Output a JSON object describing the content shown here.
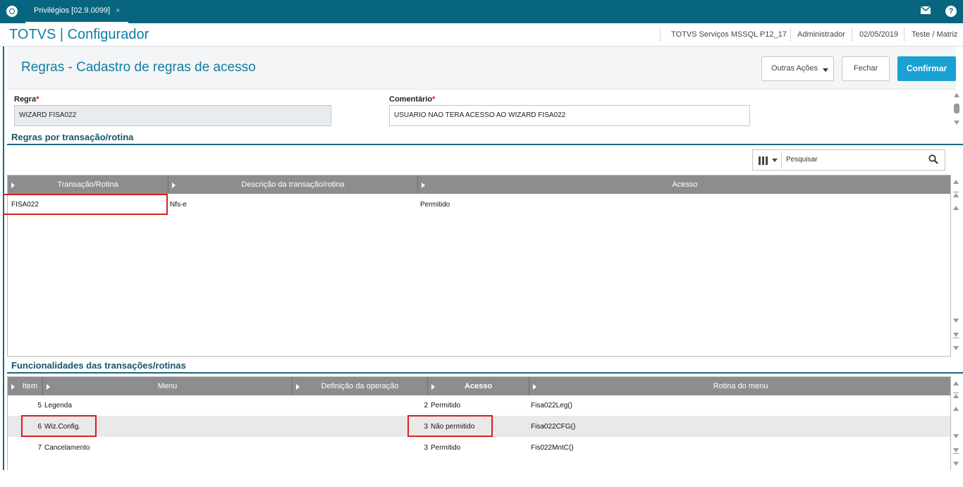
{
  "topbar": {
    "tab_label": "Privilégios [02.9.0099]",
    "tab_close": "×",
    "mail_icon": "envelope-icon",
    "help_label": "?"
  },
  "header": {
    "app_title": "TOTVS | Configurador",
    "environment": "TOTVS Serviços MSSQL P12_17",
    "user": "Administrador",
    "date": "02/05/2019",
    "company": "Teste / Matriz"
  },
  "page": {
    "title": "Regras - Cadastro de regras de acesso",
    "btn_other": "Outras Ações",
    "btn_close": "Fechar",
    "btn_confirm": "Confirmar"
  },
  "form": {
    "rule_label": "Regra",
    "rule_value": "WIZARD FISA022",
    "comment_label": "Comentário",
    "comment_value": "USUARIO NAO TERA ACESSO AO WIZARD FISA022",
    "required_mark": "*"
  },
  "section1": {
    "title": "Regras por transação/rotina",
    "search_placeholder": "Pesquisar",
    "columns": [
      "Transação/Rotina",
      "Descrição da transação/rotina",
      "Acesso"
    ],
    "rows": [
      {
        "routine": "FISA022",
        "description": "Nfs-e",
        "access": "Permitido"
      }
    ]
  },
  "section2": {
    "title": "Funcionalidades das transações/rotinas",
    "columns": [
      "Item",
      "Menu",
      "Definição da operação",
      "Acesso",
      "Rotina do menu"
    ],
    "rows": [
      {
        "item": "5",
        "menu": "Legenda",
        "access_code": "2",
        "access": "Permitido",
        "routine": "Fisa022Leg()"
      },
      {
        "item": "6",
        "menu": "Wiz.Config.",
        "access_code": "3",
        "access": "Não permitido",
        "routine": "Fisa022CFG()"
      },
      {
        "item": "7",
        "menu": "Cancelamento",
        "access_code": "3",
        "access": "Permitido",
        "routine": "Fis022MntC()"
      }
    ]
  },
  "colors": {
    "topbar": "#08657f",
    "accent": "#1aa1d3",
    "highlight": "#d7201f"
  }
}
